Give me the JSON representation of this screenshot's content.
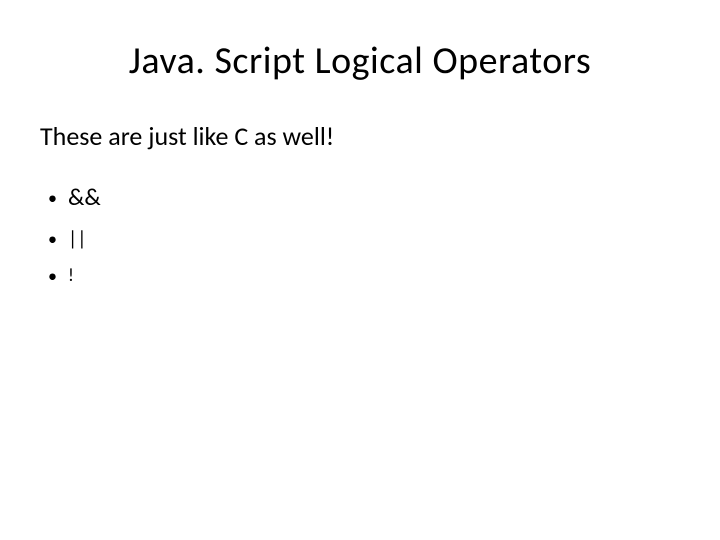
{
  "slide": {
    "title": "Java. Script Logical Operators",
    "subtitle": "These are just like C as well!",
    "items": [
      {
        "text": "&&"
      },
      {
        "text": "||"
      },
      {
        "text": "!"
      }
    ]
  }
}
